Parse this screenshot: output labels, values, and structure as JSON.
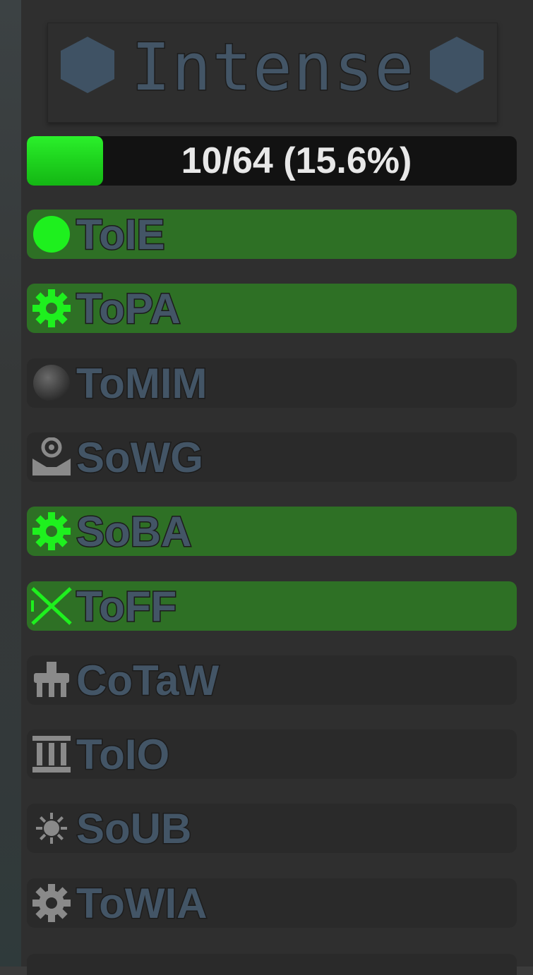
{
  "title": "Intense",
  "progress": {
    "text": "10/64 (15.6%)",
    "completed": 10,
    "total": 64,
    "fill_fraction": 0.156,
    "fill_color": "#22e022"
  },
  "colors": {
    "done_row": "#2e7025",
    "pending_row": "#2a2a2a",
    "done_icon": "#1ef01e",
    "pending_icon": "#8a8a8a",
    "label_fill": "#435566",
    "hexagon": "#3f5264"
  },
  "towers": [
    {
      "label": "ToIE",
      "icon": "circle-icon",
      "completed": true
    },
    {
      "label": "ToPA",
      "icon": "gear-icon",
      "completed": true
    },
    {
      "label": "ToMIM",
      "icon": "sphere-icon",
      "completed": false
    },
    {
      "label": "SoWG",
      "icon": "pedestal-icon",
      "completed": false
    },
    {
      "label": "SoBA",
      "icon": "gear-icon",
      "completed": true
    },
    {
      "label": "ToFF",
      "icon": "crossed-lines-icon",
      "completed": true
    },
    {
      "label": "CoTaW",
      "icon": "tripod-icon",
      "completed": false
    },
    {
      "label": "ToIO",
      "icon": "pillars-icon",
      "completed": false
    },
    {
      "label": "SoUB",
      "icon": "sun-icon",
      "completed": false
    },
    {
      "label": "ToWIA",
      "icon": "cog-icon",
      "completed": false
    }
  ]
}
